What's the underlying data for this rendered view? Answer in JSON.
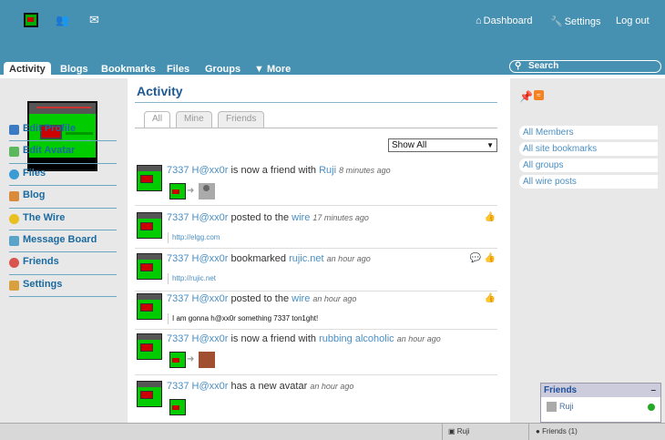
{
  "topbar": {
    "dashboard": "Dashboard",
    "settings": "Settings",
    "logout": "Log out"
  },
  "tabs": [
    "Activity",
    "Blogs",
    "Bookmarks",
    "Files",
    "Groups",
    "More"
  ],
  "search": {
    "placeholder": "Search"
  },
  "sidebar": {
    "items": [
      {
        "label": "Edit Profile",
        "icon": "profile-icon",
        "color": "#3b7bc4"
      },
      {
        "label": "Edit Avatar",
        "icon": "avatar-icon",
        "color": "#5cb85c"
      },
      {
        "label": "Files",
        "icon": "files-icon",
        "color": "#3b9bd4"
      },
      {
        "label": "Blog",
        "icon": "blog-icon",
        "color": "#d98a3a"
      },
      {
        "label": "The Wire",
        "icon": "wire-icon",
        "color": "#e8c020"
      },
      {
        "label": "Message Board",
        "icon": "messageboard-icon",
        "color": "#59a3c8"
      },
      {
        "label": "Friends",
        "icon": "heart-icon",
        "color": "#d9534f"
      },
      {
        "label": "Settings",
        "icon": "tools-icon",
        "color": "#d9a040"
      }
    ]
  },
  "main": {
    "title": "Activity",
    "filter_tabs": [
      "All",
      "Mine",
      "Friends"
    ],
    "select_value": "Show All",
    "entries": [
      {
        "user": "7337 H@xx0r",
        "action": " is now a friend with ",
        "target": "Ruji",
        "time": "8 minutes ago",
        "excerpt": ""
      },
      {
        "user": "7337 H@xx0r",
        "action": " posted to the ",
        "target": "wire",
        "time": "17 minutes ago",
        "excerpt": "http://elgg.com"
      },
      {
        "user": "7337 H@xx0r",
        "action": " bookmarked ",
        "target": "rujic.net",
        "time": "an hour ago",
        "excerpt": "http://rujic.net"
      },
      {
        "user": "7337 H@xx0r",
        "action": " posted to the ",
        "target": "wire",
        "time": "an hour ago",
        "excerpt": "I am gonna h@xx0r something 7337 ton1ght!"
      },
      {
        "user": "7337 H@xx0r",
        "action": " is now a friend with ",
        "target": "rubbing alcoholic",
        "time": "an hour ago",
        "excerpt": ""
      },
      {
        "user": "7337 H@xx0r",
        "action": " has a new avatar",
        "target": "",
        "time": "an hour ago",
        "excerpt": ""
      }
    ]
  },
  "right": {
    "links": [
      "All Members",
      "All site bookmarks",
      "All groups",
      "All wire posts"
    ]
  },
  "friends_popup": {
    "title": "Friends",
    "close": "–",
    "friend": "Ruji"
  },
  "bottombar": {
    "user": "Ruji",
    "friends": "Friends (1)"
  }
}
